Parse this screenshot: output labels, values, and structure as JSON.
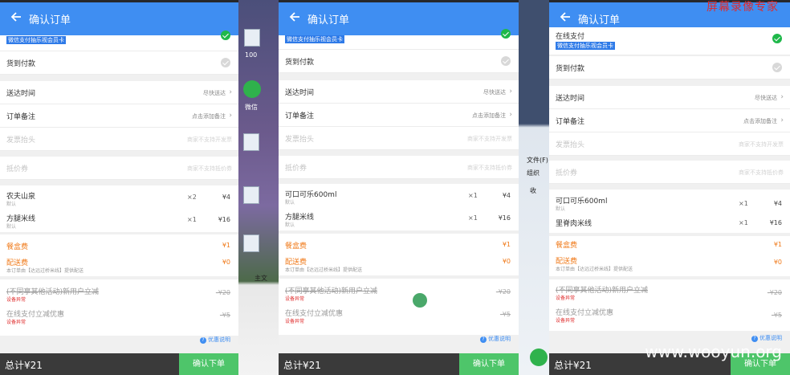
{
  "screens": [
    {
      "title": "确认订单",
      "pay_tag": "微信支付抽乐视会员卡",
      "cod_label": "货到付款",
      "delivery_time_label": "送达时间",
      "delivery_time_value": "尽快送达",
      "note_label": "订单备注",
      "note_value": "点击添加备注",
      "invoice_label": "发票抬头",
      "invoice_value": "商家不支持开发票",
      "voucher_label": "抵价券",
      "voucher_value": "商家不支持抵价券",
      "items": [
        {
          "name": "农夫山泉",
          "sub": "默认",
          "qty": "×2",
          "price": "¥4"
        },
        {
          "name": "方腿米线",
          "sub": "默认",
          "qty": "×1",
          "price": "¥16"
        }
      ],
      "box_fee_label": "餐盒费",
      "box_fee_value": "¥1",
      "delivery_fee_label": "配送费",
      "delivery_fee_sub": "本订单由【达远过桥米线】提供配送",
      "delivery_fee_value": "¥0",
      "promo1_label": "(不同享其他活动)新用户立减",
      "promo1_sub": "设备异常",
      "promo1_value": "-¥20",
      "promo2_label": "在线支付立减优惠",
      "promo2_sub": "设备异常",
      "promo2_value": "-¥5",
      "help_label": "优惠说明",
      "total_label": "总计¥21",
      "order_button": "确认下单"
    },
    {
      "title": "确认订单",
      "pay_tag": "微信支付抽乐视会员卡",
      "cod_label": "货到付款",
      "delivery_time_label": "送达时间",
      "delivery_time_value": "尽快送达",
      "note_label": "订单备注",
      "note_value": "点击添加备注",
      "invoice_label": "发票抬头",
      "invoice_value": "商家不支持开发票",
      "voucher_label": "抵价券",
      "voucher_value": "商家不支持抵价券",
      "items": [
        {
          "name": "可口可乐600ml",
          "sub": "默认",
          "qty": "×1",
          "price": "¥4"
        },
        {
          "name": "方腿米线",
          "sub": "默认",
          "qty": "×1",
          "price": "¥16"
        }
      ],
      "box_fee_label": "餐盒费",
      "box_fee_value": "¥1",
      "delivery_fee_label": "配送费",
      "delivery_fee_sub": "本订单由【达远过桥米线】提供配送",
      "delivery_fee_value": "¥0",
      "promo1_label": "(不同享其他活动)新用户立减",
      "promo1_sub": "设备异常",
      "promo1_value": "-¥20",
      "promo2_label": "在线支付立减优惠",
      "promo2_sub": "设备异常",
      "promo2_value": "-¥5",
      "help_label": "优惠说明",
      "total_label": "总计¥21",
      "order_button": "确认下单"
    },
    {
      "title": "确认订单",
      "online_pay_label": "在线支付",
      "pay_tag": "微信支付抽乐视会员卡",
      "cod_label": "货到付款",
      "delivery_time_label": "送达时间",
      "delivery_time_value": "尽快送达",
      "note_label": "订单备注",
      "note_value": "点击添加备注",
      "invoice_label": "发票抬头",
      "invoice_value": "商家不支持开发票",
      "voucher_label": "抵价券",
      "voucher_value": "商家不支持抵价券",
      "items": [
        {
          "name": "可口可乐600ml",
          "sub": "默认",
          "qty": "×1",
          "price": "¥4"
        },
        {
          "name": "里脊肉米线",
          "sub": "",
          "qty": "×1",
          "price": "¥16"
        }
      ],
      "box_fee_label": "餐盒费",
      "box_fee_value": "¥1",
      "delivery_fee_label": "配送费",
      "delivery_fee_sub": "本订单由【达远过桥米线】提供配送",
      "delivery_fee_value": "¥0",
      "promo1_label": "(不同享其他活动)新用户立减",
      "promo1_sub": "设备异常",
      "promo1_value": "-¥20",
      "promo2_label": "在线支付立减优惠",
      "promo2_sub": "设备异常",
      "promo2_value": "-¥5",
      "help_label": "优惠说明",
      "total_label": "总计¥21",
      "order_button": "确认下单"
    }
  ],
  "desktop": {
    "icon_labels": [
      "100",
      "微信",
      "主文",
      "文件(F)",
      "组织",
      "收"
    ]
  },
  "watermarks": {
    "top": "屏幕录像专家",
    "bottom": "www.wooyun.org"
  },
  "colors": {
    "header_blue": "#3f8ef2",
    "confirm_green": "#4ec56a",
    "check_green": "#1fb84a",
    "fee_orange": "#f07a1a",
    "warning_red": "#e03030",
    "bottom_bar": "#3a3a3a"
  }
}
